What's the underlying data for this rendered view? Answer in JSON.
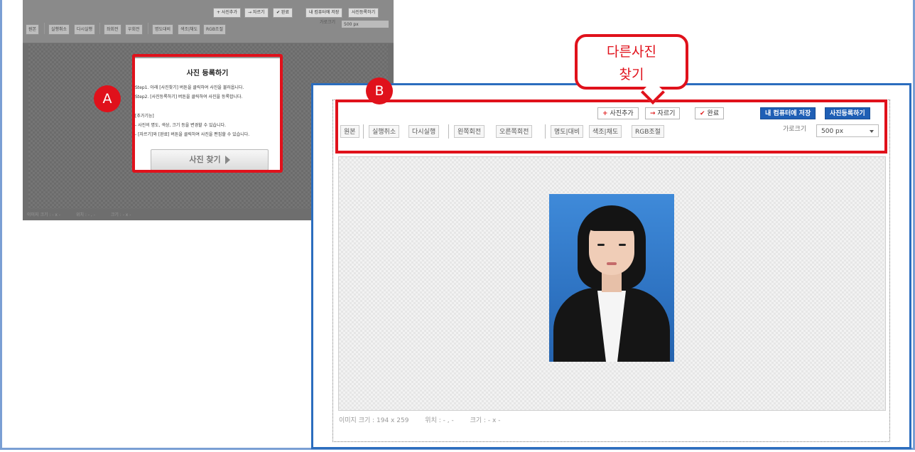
{
  "panelA": {
    "top_buttons": [
      "+ 사진추가",
      "→ 자르기",
      "✔ 완료",
      "내 컴퓨터에 저장",
      "사진등록하기"
    ],
    "toolbar": [
      "원본",
      "실행취소",
      "다시실행",
      "좌회전",
      "우회전",
      "명도대비",
      "색조|채도",
      "RGB조절"
    ],
    "width_label": "가로크기",
    "width_value": "500 px",
    "modal": {
      "title": "사진 등록하기",
      "step1": "Step1. 아래 [사진찾기] 버튼을 클릭하여 사진을 불러옵니다.",
      "step2": "Step2. [사진등록하기] 버튼을 클릭하여 사진을 등록합니다.",
      "extra_title": "[추가기능]",
      "extra1": "- 사진의 명도, 색상, 크기 등을 변경할 수 있습니다.",
      "extra2": "- [자르기]와 [완료] 버튼을 클릭하여 사진을 편집할 수 있습니다.",
      "find_button": "사진 찾기"
    },
    "status": [
      "이미지 크기 : - x -",
      "위치 : - , -",
      "크기 : - x -"
    ],
    "marker": "A"
  },
  "panelB": {
    "marker": "B",
    "bubble_line1": "다른사진",
    "bubble_line2": "찾기",
    "top_buttons": {
      "add": "사진추가",
      "crop": "자르기",
      "done": "완료",
      "save": "내 컴퓨터에 저장",
      "register": "사진등록하기"
    },
    "toolbar": {
      "original": "원본",
      "undo": "실행취소",
      "redo": "다시실행",
      "rotate_left": "왼쪽회전",
      "rotate_right": "오른쪽회전",
      "brightness": "명도|대비",
      "hue": "색조|채도",
      "rgb": "RGB조절"
    },
    "width_label": "가로크기",
    "width_value": "500 px",
    "status": {
      "image_size": "이미지 크기 :  194 x 259",
      "position": "위치 :  - , -",
      "size": "크기 :  - x -"
    }
  },
  "colors": {
    "highlight_red": "#e0111b",
    "frame_blue": "#2b6dbe",
    "register_blue": "#1f5fb5"
  }
}
